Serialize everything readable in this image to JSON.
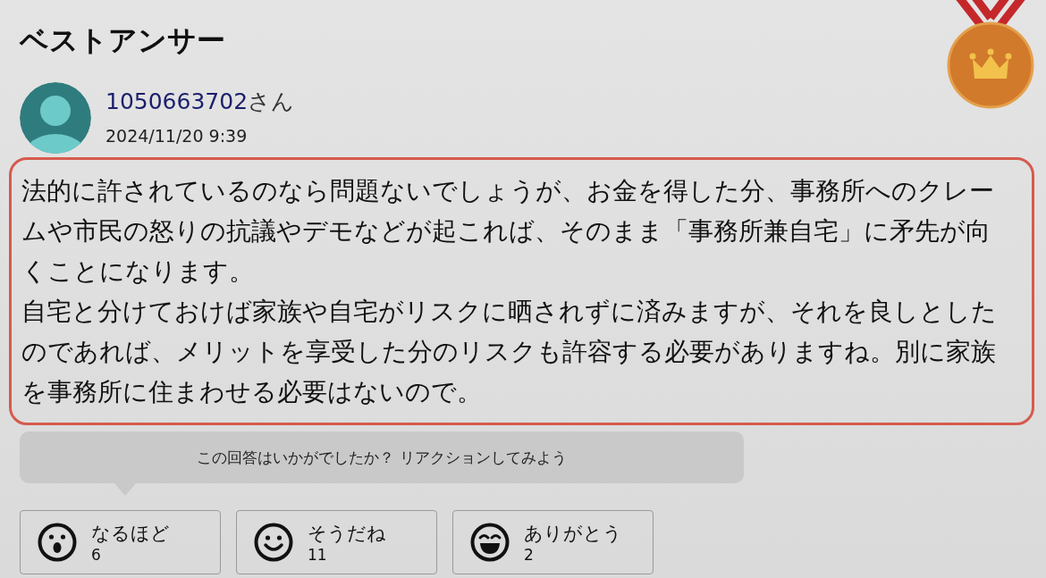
{
  "title": "ベストアンサー",
  "answer": {
    "user": {
      "name": "1050663702",
      "suffix": "さん",
      "date": "2024/11/20 9:39"
    },
    "paragraphs": [
      "法的に許されているのなら問題ないでしょうが、お金を得した分、事務所へのクレームや市民の怒りの抗議やデモなどが起これば、そのまま「事務所兼自宅」に矛先が向くことになります。",
      "自宅と分けておけば家族や自宅がリスクに晒されずに済みますが、それを良しとしたのであれば、メリットを享受した分のリスクも許容する必要がありますね。別に家族を事務所に住まわせる必要はないので。"
    ]
  },
  "reaction_prompt": "この回答はいかがでしたか？ リアクションしてみよう",
  "reactions": [
    {
      "label": "なるほど",
      "count": "6"
    },
    {
      "label": "そうだね",
      "count": "11"
    },
    {
      "label": "ありがとう",
      "count": "2"
    }
  ]
}
